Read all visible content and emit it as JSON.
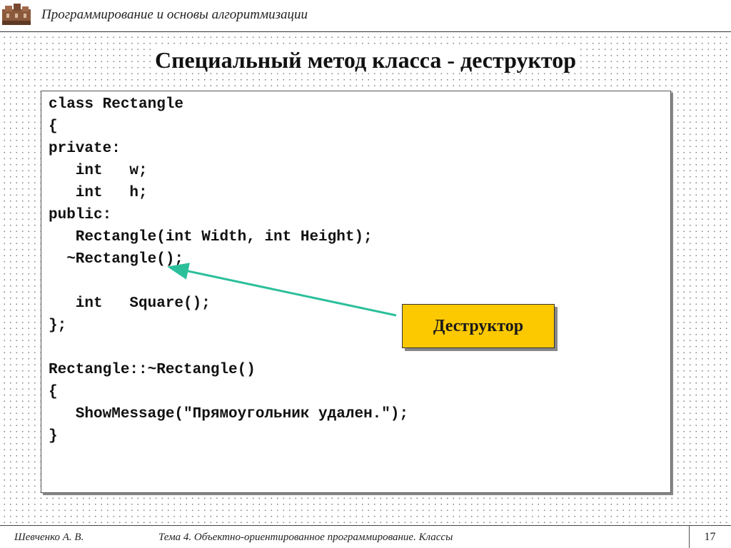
{
  "header": {
    "title": "Программирование и основы алгоритмизации",
    "logo_icon": "castle-logo-icon"
  },
  "slide": {
    "title": "Специальный метод класса - деструктор",
    "code_lines": [
      "class Rectangle",
      "{",
      "private:",
      "   int   w;",
      "   int   h;",
      "public:",
      "   Rectangle(int Width, int Height);",
      "  ~Rectangle();",
      "",
      "   int   Square();",
      "};",
      "",
      "Rectangle::~Rectangle()",
      "{",
      "   ShowMessage(\"Прямоугольник удален.\");",
      "}"
    ],
    "callout": {
      "label": "Деструктор",
      "color": "#fcc800",
      "arrow_color": "#2bbf9b"
    }
  },
  "footer": {
    "author": "Шевченко А. В.",
    "topic": "Тема 4. Объектно-ориентированное программирование. Классы",
    "page": "17"
  }
}
